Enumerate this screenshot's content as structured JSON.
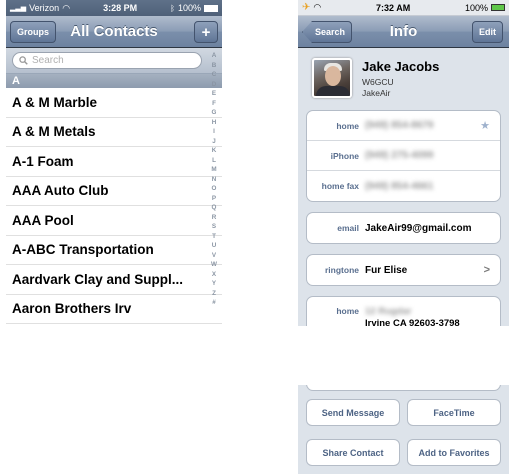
{
  "left_screen": {
    "status": {
      "carrier": "Verizon",
      "time": "3:28 PM",
      "battery": "100%"
    },
    "nav": {
      "title": "All Contacts",
      "left_button": "Groups",
      "right_button": "+"
    },
    "search": {
      "placeholder": "Search"
    },
    "section_header": "A",
    "contacts": [
      "A & M Marble",
      "A & M Metals",
      "A-1 Foam",
      "AAA Auto Club",
      "AAA Pool",
      "A-ABC Transportation",
      "Aardvark Clay and Suppl...",
      "Aaron Brothers Irv"
    ],
    "index_letters": [
      "A",
      "B",
      "C",
      "D",
      "E",
      "F",
      "G",
      "H",
      "I",
      "J",
      "K",
      "L",
      "M",
      "N",
      "O",
      "P",
      "Q",
      "R",
      "S",
      "T",
      "U",
      "V",
      "W",
      "X",
      "Y",
      "Z",
      "#"
    ]
  },
  "right_screen": {
    "status": {
      "time": "7:32 AM",
      "battery": "100%"
    },
    "nav": {
      "title": "Info",
      "back_button": "Search",
      "right_button": "Edit"
    },
    "contact": {
      "name": "Jake Jacobs",
      "line1": "W6GCU",
      "line2": "JakeAir"
    },
    "phones": [
      {
        "label": "home",
        "value": "(949) 854-8679"
      },
      {
        "label": "iPhone",
        "value": "(949) 275-4099"
      },
      {
        "label": "home fax",
        "value": "(949) 854-4661"
      }
    ],
    "email": {
      "label": "email",
      "value": "JakeAir99@gmail.com"
    },
    "ringtone": {
      "label": "ringtone",
      "value": "Fur Elise"
    },
    "address": {
      "label": "home",
      "street": "12 Rugdar",
      "city": "Irvine CA 92603-3798"
    }
  },
  "actions": {
    "send_message": "Send Message",
    "facetime": "FaceTime",
    "share_contact": "Share Contact",
    "add_favorites": "Add to Favorites"
  },
  "colors": {
    "nav_blue": "#6d82a0",
    "label_blue": "#5a6f8f",
    "group_bg": "#dde3ea"
  }
}
